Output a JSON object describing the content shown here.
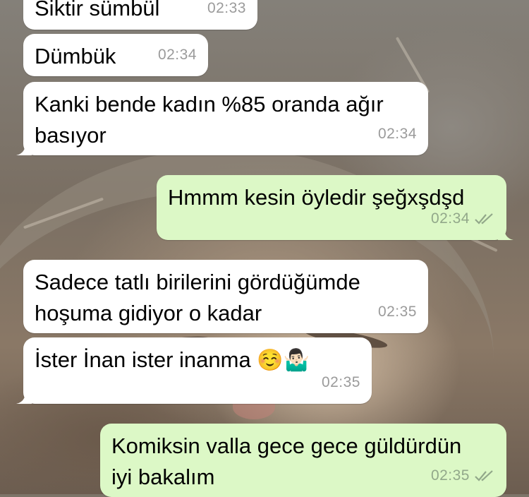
{
  "messages": [
    {
      "text": "Siktir sümbül",
      "time": "02:33",
      "dir": "in"
    },
    {
      "text": "Dümbük",
      "time": "02:34",
      "dir": "in"
    },
    {
      "text": "Kanki bende kadın %85 oranda ağır\nbasıyor",
      "time": "02:34",
      "dir": "in"
    },
    {
      "text": "Hmmm kesin öyledir şeğxşdşd",
      "time": "02:34",
      "dir": "out",
      "status": "read-double-check-icon"
    },
    {
      "text": "Sadece tatlı birilerini gördüğümde\nhoşuma gidiyor o kadar",
      "time": "02:35",
      "dir": "in"
    },
    {
      "text": "İster İnan ister inanma",
      "emojis": [
        "☺️",
        "🤷🏻‍♂️"
      ],
      "time": "02:35",
      "dir": "in"
    },
    {
      "text": "Komiksin valla gece gece güldürdün\niyi bakalım",
      "time": "02:35",
      "dir": "out",
      "status": "read-double-check-icon"
    }
  ],
  "colors": {
    "incoming_bubble": "#ffffff",
    "outgoing_bubble": "#dcf8c6",
    "timestamp": "#9b9b9b"
  }
}
